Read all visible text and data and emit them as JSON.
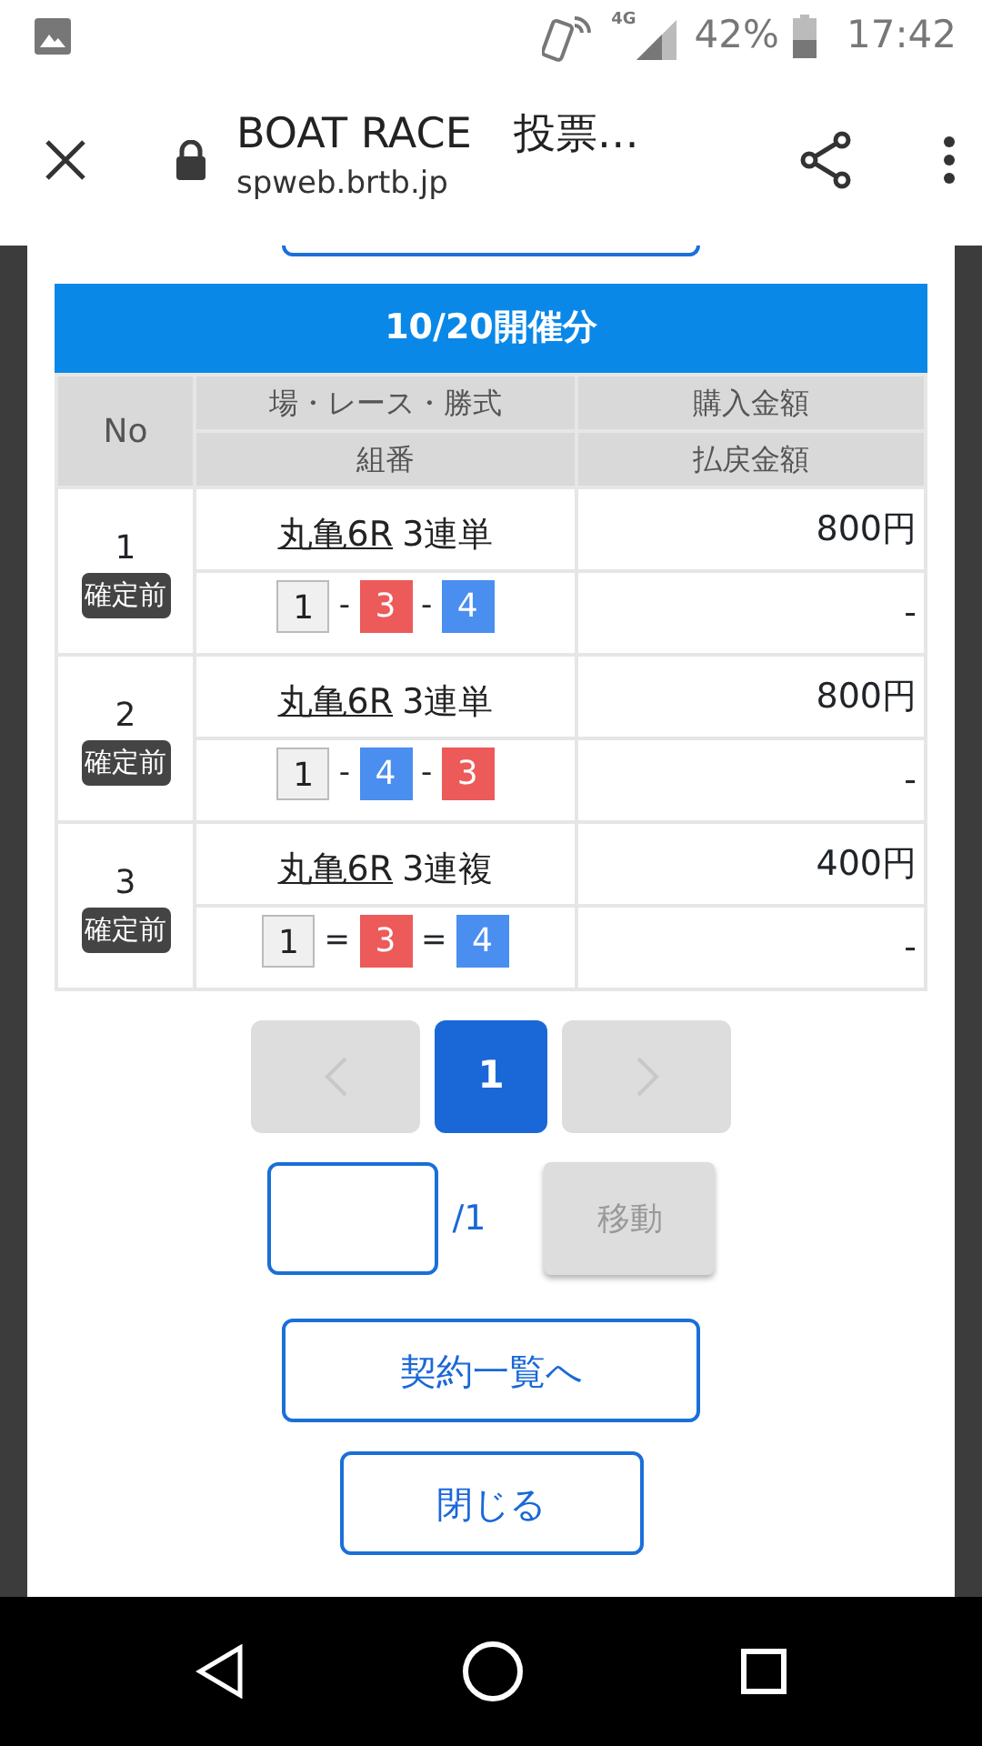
{
  "status_bar": {
    "network": "4G",
    "battery": "42%",
    "time": "17:42"
  },
  "browser": {
    "title": "BOAT RACE　投票…",
    "url": "spweb.brtb.jp"
  },
  "section_title": "10/20開催分",
  "table": {
    "header": {
      "no": "No",
      "race": "場・レース・勝式",
      "amount": "購入金額",
      "combination": "組番",
      "payout": "払戻金額"
    },
    "rows": [
      {
        "no": "1",
        "status": "確定前",
        "race": "丸亀6R",
        "bet_type": "3連単",
        "boats": [
          {
            "number": "1",
            "color": "#f0f0f0"
          },
          {
            "number": "3",
            "color": "#ec5a5a"
          },
          {
            "number": "4",
            "color": "#4a8ef0"
          }
        ],
        "separators": [
          "-",
          "-"
        ],
        "amount": "800円",
        "payout": "-"
      },
      {
        "no": "2",
        "status": "確定前",
        "race": "丸亀6R",
        "bet_type": "3連単",
        "boats": [
          {
            "number": "1",
            "color": "#f0f0f0"
          },
          {
            "number": "4",
            "color": "#4a8ef0"
          },
          {
            "number": "3",
            "color": "#ec5a5a"
          }
        ],
        "separators": [
          "-",
          "-"
        ],
        "amount": "800円",
        "payout": "-"
      },
      {
        "no": "3",
        "status": "確定前",
        "race": "丸亀6R",
        "bet_type": "3連複",
        "boats": [
          {
            "number": "1",
            "color": "#f0f0f0"
          },
          {
            "number": "3",
            "color": "#ec5a5a"
          },
          {
            "number": "4",
            "color": "#4a8ef0"
          }
        ],
        "separators": [
          "=",
          "="
        ],
        "amount": "400円",
        "payout": "-"
      }
    ]
  },
  "pagination": {
    "prev_disabled": true,
    "pages": [
      {
        "label": "1",
        "selected": true
      }
    ],
    "next_disabled": true
  },
  "jump": {
    "total": "/1",
    "button": "移動",
    "button_disabled": true
  },
  "buttons": [
    "契約一覧へ",
    "閉じる"
  ]
}
